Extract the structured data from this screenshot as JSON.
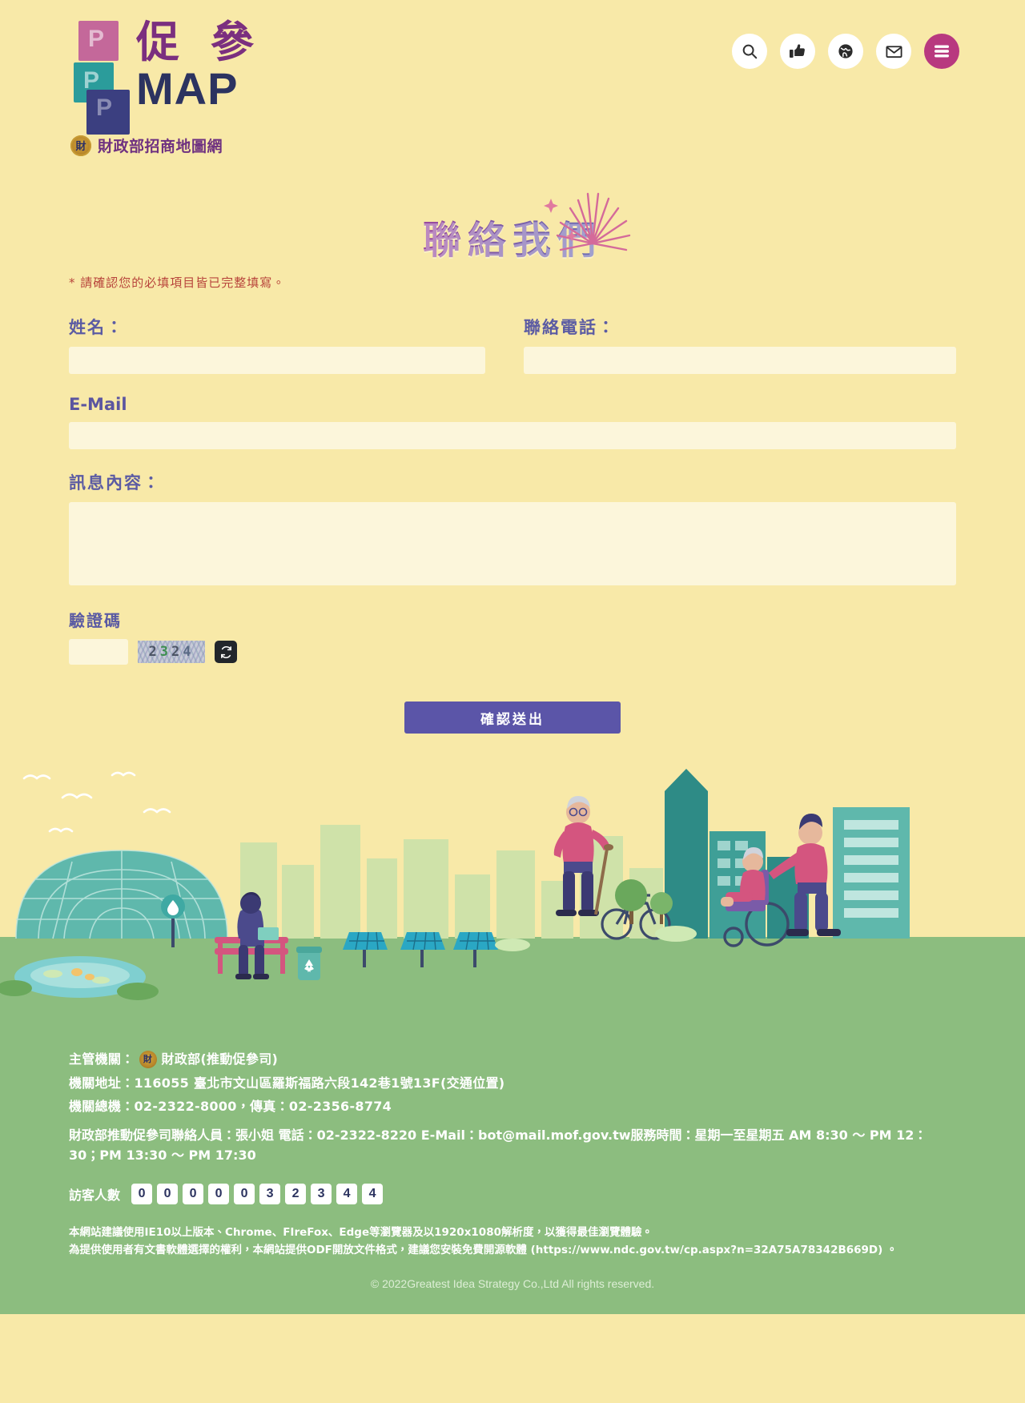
{
  "brand": {
    "logo_cn": "促 參",
    "logo_map": "MAP",
    "logo_sub": "財政部招商地圖網",
    "seal_char": "財",
    "block_letter": "P"
  },
  "header": {
    "icons": [
      {
        "name": "search-icon",
        "label": "搜尋"
      },
      {
        "name": "thumbs-up-icon",
        "label": "按讚"
      },
      {
        "name": "globe-icon",
        "label": "語言"
      },
      {
        "name": "mail-icon",
        "label": "聯絡信箱"
      },
      {
        "name": "hamburger-menu-icon",
        "label": "選單"
      }
    ],
    "menu_color": "#b8397f"
  },
  "page": {
    "title": "聯絡我們"
  },
  "form": {
    "required_note": "* 請確認您的必填項目皆已完整填寫。",
    "name_label": "姓名：",
    "name_value": "",
    "name_placeholder": "",
    "phone_label": "聯絡電話：",
    "phone_value": "",
    "phone_placeholder": "",
    "email_label": "E-Mail",
    "email_value": "",
    "email_placeholder": "",
    "message_label": "訊息內容：",
    "message_value": "",
    "message_placeholder": "",
    "captcha_label": "驗證碼",
    "captcha_value": "",
    "captcha_placeholder": "",
    "captcha_code": "2324",
    "refresh_label": "重新產生驗證碼",
    "submit_label": "確認送出",
    "submit_color": "#5b55a8"
  },
  "footer": {
    "authority_label": "主管機關：",
    "authority_name": "財政部(推動促參司)",
    "address": "機關地址：116055 臺北市文山區羅斯福路六段142巷1號13F(交通位置)",
    "phone_fax": "機關總機：02-2322-8000，傳真：02-2356-8774",
    "contact": "財政部推動促參司聯絡人員：張小姐 電話：02-2322-8220 E-Mail：bot@mail.mof.gov.tw服務時間：星期一至星期五 AM 8:30 ～ PM 12：30；PM 13:30 ～ PM 17:30",
    "visitors_label": "訪客人數",
    "visitors_digits": "0000032344",
    "browser_note_line1": "本網站建議使用IE10以上版本、Chrome、FIreFox、Edge等瀏覽器及以1920x1080解析度，以獲得最佳瀏覽體驗。",
    "browser_note_line2": "為提供使用者有文書軟體選擇的權利，本網站提供ODF開放文件格式，建議您安裝免費開源軟體 (https://www.ndc.gov.tw/cp.aspx?n=32A75A78342B669D) 。",
    "copyright": "© 2022Greatest Idea Strategy Co.,Ltd All rights reserved.",
    "background_color": "#8cbd7f"
  }
}
